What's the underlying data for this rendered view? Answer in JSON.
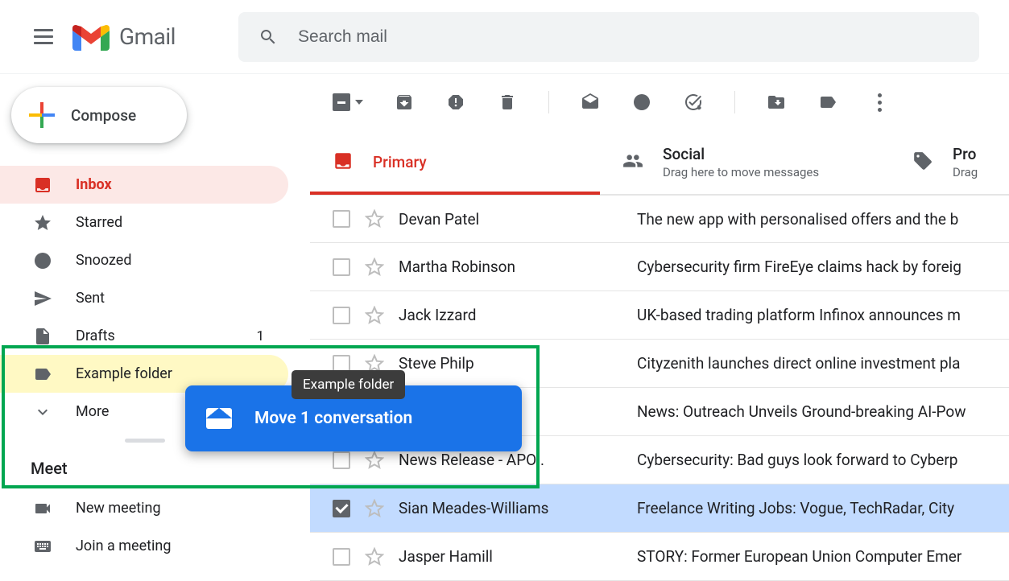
{
  "header": {
    "app_name": "Gmail",
    "search_placeholder": "Search mail"
  },
  "compose_label": "Compose",
  "sidebar": [
    {
      "icon": "inbox",
      "label": "Inbox",
      "active": true,
      "hl": false,
      "count": ""
    },
    {
      "icon": "star",
      "label": "Starred",
      "active": false,
      "hl": false,
      "count": ""
    },
    {
      "icon": "clock",
      "label": "Snoozed",
      "active": false,
      "hl": false,
      "count": ""
    },
    {
      "icon": "send",
      "label": "Sent",
      "active": false,
      "hl": false,
      "count": ""
    },
    {
      "icon": "draft",
      "label": "Drafts",
      "active": false,
      "hl": false,
      "count": "1"
    },
    {
      "icon": "label",
      "label": "Example folder",
      "active": false,
      "hl": true,
      "count": ""
    },
    {
      "icon": "expand",
      "label": "More",
      "active": false,
      "hl": false,
      "count": ""
    }
  ],
  "meet": {
    "header": "Meet",
    "items": [
      {
        "icon": "video",
        "label": "New meeting"
      },
      {
        "icon": "keyboard",
        "label": "Join a meeting"
      }
    ]
  },
  "tabs": [
    {
      "icon": "inbox",
      "label": "Primary",
      "sub": "",
      "active": true
    },
    {
      "icon": "people",
      "label": "Social",
      "sub": "Drag here to move messages",
      "active": false
    },
    {
      "icon": "tag",
      "label": "Pro",
      "sub": "Drag",
      "active": false
    }
  ],
  "emails": [
    {
      "sender": "Devan Patel",
      "subject": "The new app with personalised offers and the b",
      "selected": false
    },
    {
      "sender": "Martha Robinson",
      "subject": "Cybersecurity firm FireEye claims hack by foreig",
      "selected": false
    },
    {
      "sender": "Jack Izzard",
      "subject": "UK-based trading platform Infinox announces m",
      "selected": false
    },
    {
      "sender": "Steve Philp",
      "subject": "Cityzenith launches direct online investment pla",
      "selected": false
    },
    {
      "sender": "",
      "subject": "News: Outreach Unveils Ground-breaking AI-Pow",
      "selected": false
    },
    {
      "sender": "News Release - APO .",
      "subject": "Cybersecurity: Bad guys look forward to Cyberp",
      "selected": false
    },
    {
      "sender": "Sian Meades-Williams",
      "subject": "Freelance Writing Jobs: Vogue, TechRadar, City",
      "selected": true
    },
    {
      "sender": "Jasper Hamill",
      "subject": "STORY: Former European Union Computer Emer",
      "selected": false
    }
  ],
  "drag": {
    "tooltip": "Example folder",
    "card": "Move 1 conversation"
  }
}
